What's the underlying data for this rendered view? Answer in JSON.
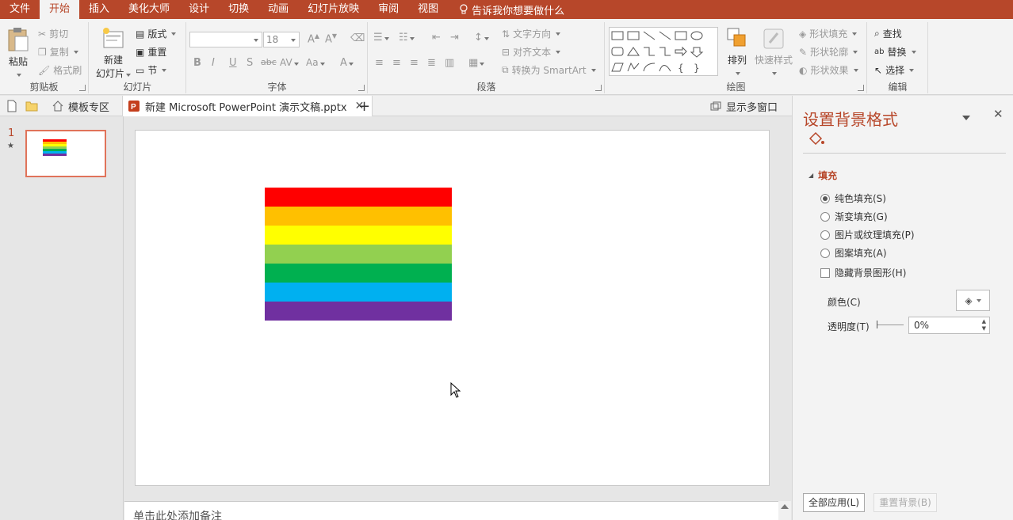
{
  "menu": {
    "items": [
      "文件",
      "开始",
      "插入",
      "美化大师",
      "设计",
      "切换",
      "动画",
      "幻灯片放映",
      "审阅",
      "视图"
    ],
    "active_index": 1,
    "tell_me": "告诉我你想要做什么"
  },
  "ribbon": {
    "clipboard": {
      "paste": "粘贴",
      "cut": "剪切",
      "copy": "复制",
      "format_painter": "格式刷",
      "label": "剪贴板"
    },
    "slides": {
      "new_slide_1": "新建",
      "new_slide_2": "幻灯片",
      "layout": "版式",
      "reset": "重置",
      "section": "节",
      "label": "幻灯片"
    },
    "font": {
      "font_size": "18",
      "label": "字体",
      "bold": "B",
      "italic": "I",
      "underline": "U",
      "shadow": "S",
      "strike": "abc",
      "spacing": "AV",
      "case": "Aa",
      "color": "A"
    },
    "paragraph": {
      "text_direction": "文字方向",
      "align_text": "对齐文本",
      "smartart": "转换为 SmartArt",
      "label": "段落"
    },
    "drawing": {
      "arrange": "排列",
      "quick_styles": "快速样式",
      "shape_fill": "形状填充",
      "shape_outline": "形状轮廓",
      "shape_effects": "形状效果",
      "label": "绘图"
    },
    "editing": {
      "find": "查找",
      "replace": "替换",
      "select": "选择",
      "label": "编辑"
    }
  },
  "tabs": {
    "template": "模板专区",
    "document": "新建 Microsoft PowerPoint 演示文稿.pptx",
    "multi_window": "显示多窗口"
  },
  "thumbnails": {
    "slide_number": "1",
    "star": "★"
  },
  "slide": {
    "stripe_colors": [
      "#ff0000",
      "#ffc000",
      "#ffff00",
      "#92d050",
      "#00b050",
      "#00b0f0",
      "#7030a0"
    ]
  },
  "notes": {
    "placeholder": "单击此处添加备注"
  },
  "pane": {
    "title": "设置背景格式",
    "section": "填充",
    "options": [
      "纯色填充(S)",
      "渐变填充(G)",
      "图片或纹理填充(P)",
      "图案填充(A)"
    ],
    "selected_option": 0,
    "hide_bg": "隐藏背景图形(H)",
    "color_label": "颜色(C)",
    "transparency_label": "透明度(T)",
    "transparency_value": "0%",
    "apply_all": "全部应用(L)",
    "reset_bg": "重置背景(B)"
  }
}
